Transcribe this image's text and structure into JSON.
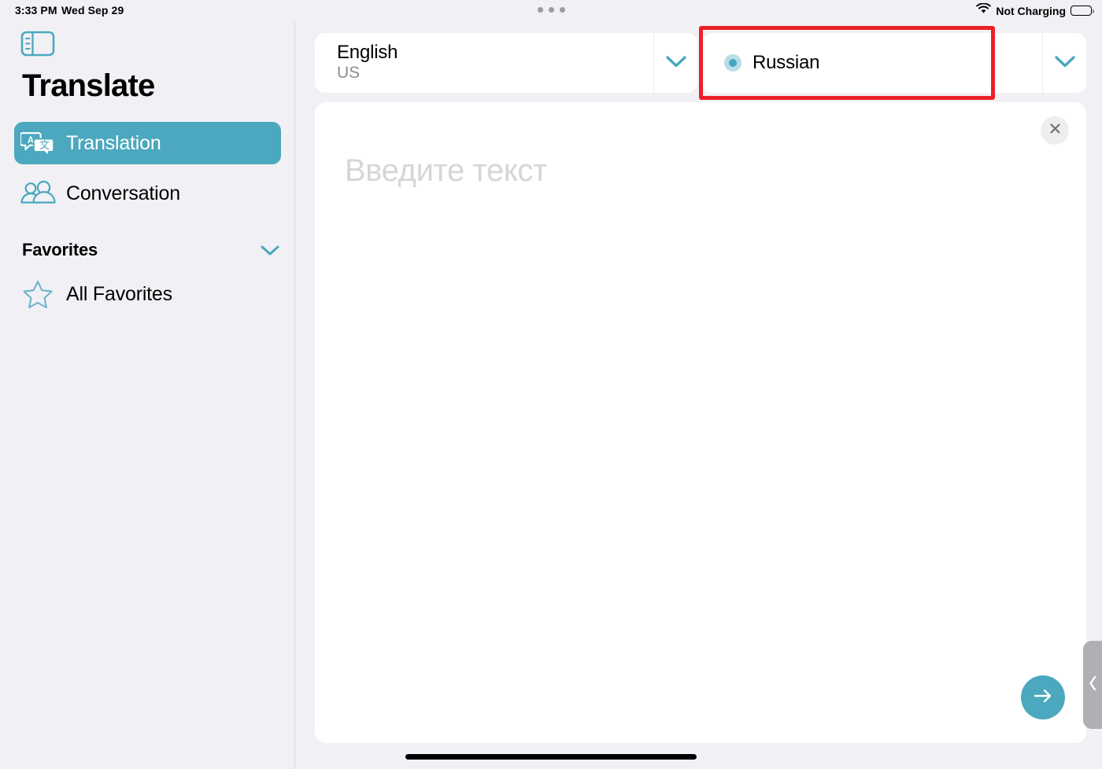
{
  "status_bar": {
    "time": "3:33 PM",
    "date": "Wed Sep 29",
    "charging_state": "Not Charging",
    "wifi_icon": "wifi-icon",
    "battery_icon": "battery-full-icon",
    "multitask_icon": "multitasking-dots-icon"
  },
  "sidebar": {
    "toggle_icon": "sidebar-toggle-icon",
    "app_title": "Translate",
    "items": [
      {
        "id": "translation",
        "label": "Translation",
        "icon": "translation-bubbles-icon",
        "selected": true
      },
      {
        "id": "conversation",
        "label": "Conversation",
        "icon": "two-people-icon",
        "selected": false
      }
    ],
    "sections": [
      {
        "id": "favorites",
        "title": "Favorites",
        "chevron_icon": "chevron-down-icon",
        "items": [
          {
            "id": "all-favorites",
            "label": "All Favorites",
            "icon": "star-outline-icon"
          }
        ]
      }
    ]
  },
  "language_bar": {
    "source": {
      "name": "English",
      "region": "US",
      "chevron_icon": "chevron-down-icon",
      "has_indicator_dot": false
    },
    "target": {
      "name": "Russian",
      "region": "",
      "chevron_icon": "chevron-down-icon",
      "has_indicator_dot": true,
      "indicator_name": "downloaded-language-dot"
    }
  },
  "main": {
    "input_placeholder": "Введите текст",
    "input_value": "",
    "clear_icon": "close-x-icon",
    "submit_icon": "arrow-right-icon"
  },
  "overlays": {
    "annotation_label": "highlight-box-russian-selector",
    "slideover_handle_icon": "chevron-left-icon",
    "home_indicator": "home-indicator-bar"
  },
  "colors": {
    "accent_teal": "#4ba8be",
    "annotation_red": "#ec2027",
    "page_background": "#f1f1f5",
    "card_background": "#ffffff",
    "placeholder_gray": "#d6d6da",
    "secondary_text": "#8e8e93"
  }
}
